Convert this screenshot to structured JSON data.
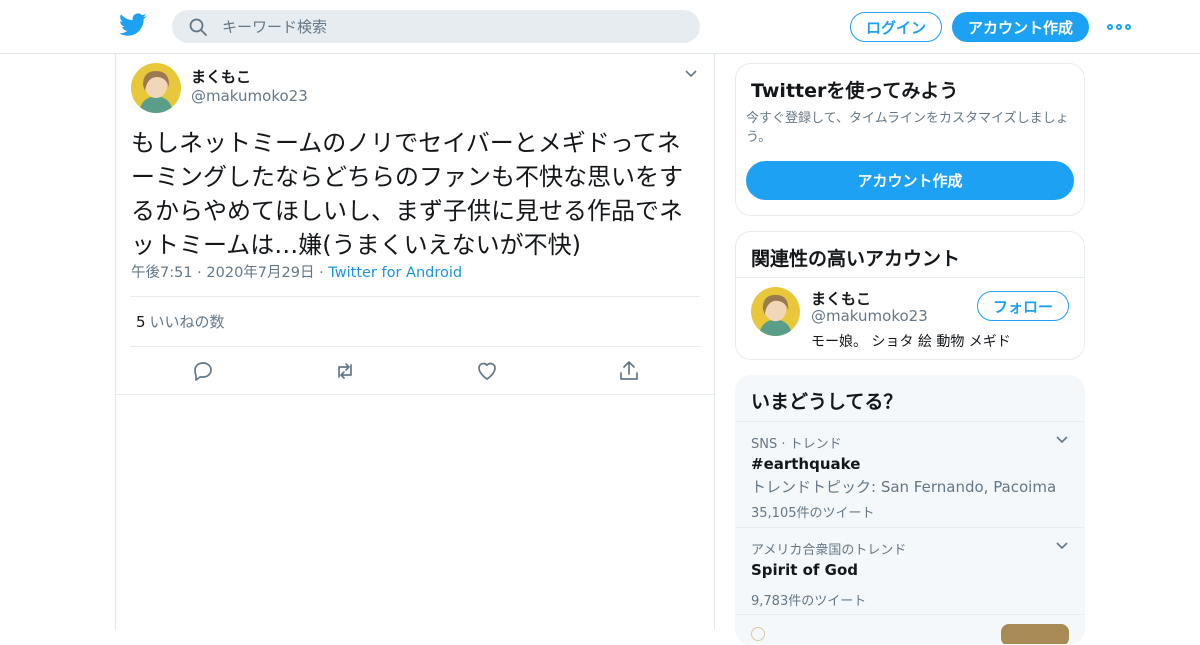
{
  "header": {
    "search_placeholder": "キーワード検索",
    "login_label": "ログイン",
    "signup_label": "アカウント作成",
    "brand_color": "#1da1f2"
  },
  "tweet": {
    "display_name": "まくもこ",
    "handle": "@makumoko23",
    "text": "もしネットミームのノリでセイバーとメギドってネーミングしたならどちらのファンも不快な思いをするからやめてほしいし、まず子供に見せる作品でネットミームは…嫌(うまくいえないが不快)",
    "time": "午後7:51",
    "date": "2020年7月29日",
    "source": "Twitter for Android",
    "likes_count": "5",
    "likes_label": "いいねの数"
  },
  "sidebar": {
    "signup_card": {
      "title": "Twitterを使ってみよう",
      "description": "今すぐ登録して、タイムラインをカスタマイズしましょう。",
      "button_label": "アカウント作成"
    },
    "related_card": {
      "title": "関連性の高いアカウント",
      "account": {
        "display_name": "まくもこ",
        "handle": "@makumoko23",
        "bio": "モー娘。 ショタ 絵 動物 メギド",
        "follow_label": "フォロー"
      }
    },
    "trends_card": {
      "title": "いまどうしてる？",
      "trends": [
        {
          "context": "SNS · トレンド",
          "title": "#earthquake",
          "subtitle": "トレンドトピック: San Fernando, Pacoima",
          "count": "35,105件のツイート"
        },
        {
          "context": "アメリカ合衆国のトレンド",
          "title": "Spirit of God",
          "count": "9,783件のツイート"
        }
      ]
    }
  }
}
